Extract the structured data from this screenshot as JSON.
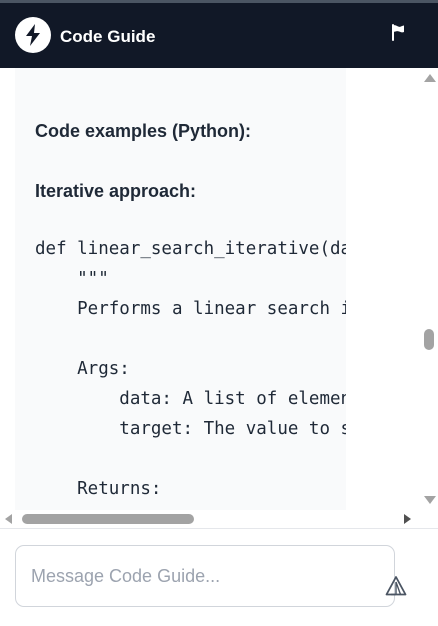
{
  "header": {
    "title": "Code Guide",
    "logo_icon": "bolt-icon",
    "flag_icon": "flag-icon",
    "background": "#111827"
  },
  "message": {
    "heading_examples": "Code examples (Python):",
    "heading_iterative": "Iterative approach:",
    "code_lines": [
      "def linear_search_iterative(data, t",
      "    \"\"\"",
      "    Performs a linear search iterat",
      "",
      "    Args:",
      "        data: A list of elements to",
      "        target: The value to search",
      "",
      "    Returns:"
    ]
  },
  "composer": {
    "placeholder": "Message Code Guide...",
    "value": "",
    "send_icon": "send-icon"
  },
  "colors": {
    "accent": "#111827",
    "text": "#1f2937",
    "message_bg": "#f9fafb",
    "scrollbar": "#a3a3a3"
  }
}
